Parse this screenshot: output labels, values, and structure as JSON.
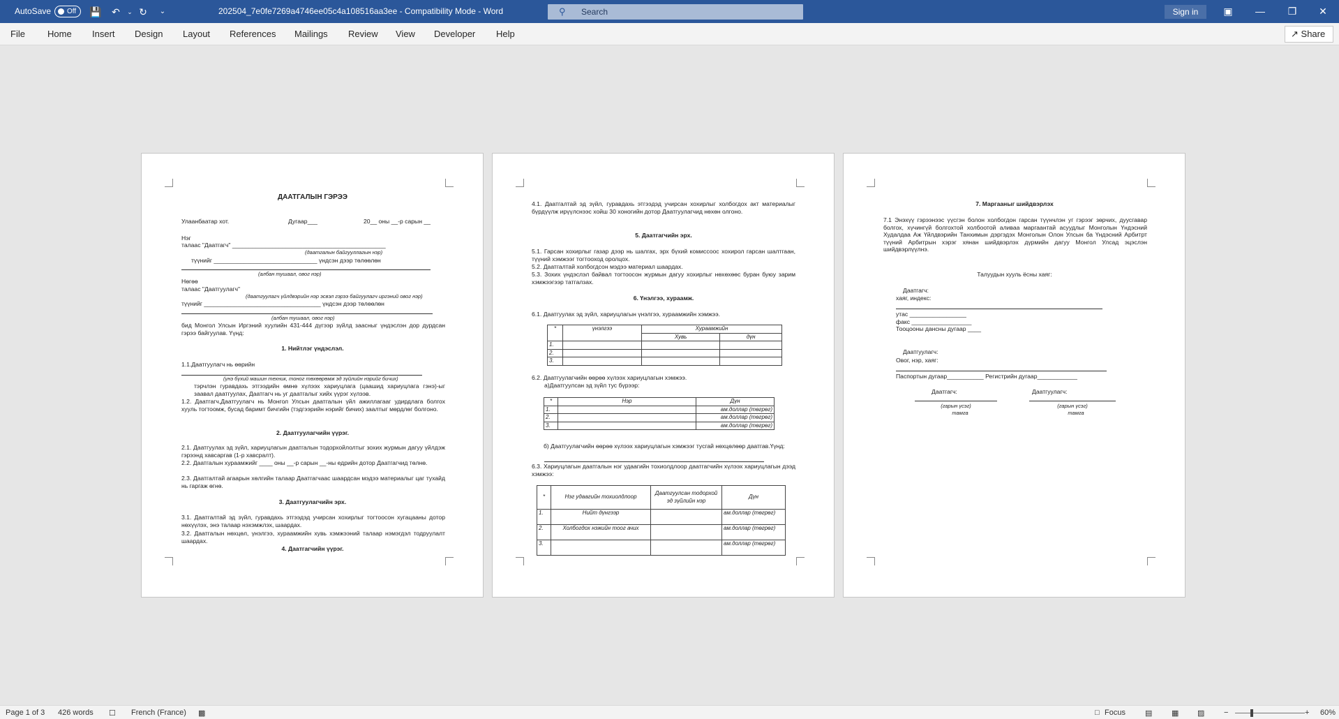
{
  "titlebar": {
    "autosave_label": "AutoSave",
    "autosave_state": "Off",
    "doc_title": "202504_7e0fe7269a4746ee05c4a108516aa3ee  -  Compatibility Mode  -  Word",
    "search_placeholder": "Search",
    "signin_label": "Sign in"
  },
  "ribbon": {
    "tabs": [
      "File",
      "Home",
      "Insert",
      "Design",
      "Layout",
      "References",
      "Mailings",
      "Review",
      "View",
      "Developer",
      "Help"
    ],
    "share_label": "Share"
  },
  "page1": {
    "title": "ДААТГАЛЫН ГЭРЭЭ",
    "city": "Улаанбаатар хот.",
    "number": "Дугаар___",
    "date": "20__ оны __-р сарын __",
    "l1": "Нэг",
    "l2": "талаас  \"Даатгагч\" ______________________________________________",
    "l3": "(даатгалын байгууллагын нэр)",
    "l4": "түүнийг _______________________________ үндсэн дээр төлөөлөн",
    "l5": "(албан тушаал, овог нэр)",
    "l6": "Нөгөө",
    "l7": "талаас  \"Даатгуулагч\"",
    "l8": "(даатгуулагч үйлдвэрийн нэр эсвэл гэрээ байгуулагч иргэний овог нэр)",
    "l9": "түүнийг ___________________________________ үндсэн дээр төлөөлөн",
    "l10": "(албан тушаал, овог нэр)",
    "l11": "бид Монгол Улсын Иргэний хуулийн 431-444 дүгээр зүйлд заасныг үндэслэн дор дурдсан гэрээ байгуулав. Үүнд:",
    "h1": "1. Нийтлэг үндэслэл.",
    "p11": "1.1.Даатгуулагч нь өөрийн",
    "p11i": "(үнэ бүхий машин техник, тоног төхөөрөмж эд зүйлийн нэрийг бичих)",
    "p11b": "тэрчлэн гуравдахь этгээдийн өмнө хүлээх хариуцлага (цаашид хариуцлага гэнэ)-ыг заавал даатгуулах, Даатгагч нь уг даатгалыг хийх үүрэг хүлээв.",
    "p12": "1.2. Даатгагч,Даатгуулагч нь Монгол Улсын даатгалын үйл ажиллагааг удирдлага болгох хууль тогтоомж, бусад баримт бичгийн (тэдгээрийн нэрийг бичих) заалтыг мөрдлөг болгоно.",
    "h2": "2. Даатгуулагчийн үүрэг.",
    "p21": "2.1. Даатгуулах эд зүйл, хариуцлагын даатгалын тодорхойлолтыг зохих журмын дагуу үйлдэж гэрээнд хавсаргав (1-р хавсралт).",
    "p22": "2.2. Даатгалын хураамжийг ____ оны __-р сарын __-ны едрийн дотор Даатгагчид төлнө.",
    "p23": "2.3. Даатгалтай агаарын хөлгийн талаар Даатгагчаас шаардсан мэдээ материалыг цаг тухайд нь гаргаж өгнө.",
    "h3": "3. Даатгуулагчийн эрх.",
    "p31": "3.1. Даатгалтай эд зүйл, гуравдахь этгээдэд учирсан хохирлыг тогтоосон хугацааны дотор нөхүүлэх, энэ талаар нэхэмжлэх, шаардах.",
    "p32": "3.2. Даатгалын нөхцөл, үнэлгээ, хураамжийн хувь хэмжээний талаар нэмэгдэл тодруулалт шаардах.",
    "h4": "4. Даатгагчийн үүрэг."
  },
  "page2": {
    "p41": "4.1. Даатгалтай эд зүйл, гуравдахь этгээдэд учирсан хохирлыг холбогдох акт материалыг бүрдүүлж ирүүлснээс хойш 30 хоногийн дотор Даатгуулагчид нөхөн олгоно.",
    "h5": "5. Даатгагчийн эрх.",
    "p51": "5.1. Гарсан хохирлыг газар дээр нь шалгах, эрх бүхий комиссоос хохирол гарсан шалтгаан, түүний хэмжээг тогтооход оролцох.",
    "p52": "5.2. Даатгалтай холбогдсон мэдээ материал шаардах.",
    "p53": "5.3. Зохих үндэслэл байвал тогтоосон журмын дагуу хохирлыг нөхөхөөс буран буюу зарим хэмжээгээр татгалзах.",
    "h6": "6. Үнэлгээ, хураамж.",
    "p61": "6.1. Даатгуулах эд зүйл, хариуцлагын үнэлгээ, хураамжийн хэмжээ.",
    "t1": {
      "h_num": "*",
      "h_val": "үнэлгээ",
      "h_fee": "Хураамжийн",
      "h_pct": "Хувь",
      "h_amt": "дүн",
      "rows": [
        "1.",
        "2.",
        "3."
      ]
    },
    "p62": "6.2. Даатгуулагчийн өөрөө хүлээх хариуцлагын хэмжээ.",
    "p62a": "а)Даатгуулсан эд зүйл тус бүрээр:",
    "t2": {
      "h_num": "*",
      "h_name": "Нэр",
      "h_amt": "Дүн",
      "rows": [
        {
          "n": "1.",
          "amt": "ам.доллар (төгрөг)"
        },
        {
          "n": "2.",
          "amt": "ам.доллар (төгрөг)"
        },
        {
          "n": "3.",
          "amt": "ам.доллар (төгрөг)"
        }
      ]
    },
    "p62b": "б) Даатгуулагчийн өөрөө хүлээх хариуцлагын хэмжээг тусгай нөхцөлөөр даатгав.Үүнд:",
    "p63": "6.3. Хариуцлагын даатгалын нэг удаагийн тохиолдлоор даатгагчийн хүлээх хариуцлагын дээд хэмжээ:",
    "t3": {
      "h_num": "*",
      "h_case": "Нэг удаагийн тохиолдлоор",
      "h_item": "Даатгуулсан тодорхой эд зүйлийн нэр",
      "h_amt": "Дүн",
      "rows": [
        {
          "n": "1.",
          "case": "Нийт дүнгээр",
          "amt": "ам.доллар (төгрөг)"
        },
        {
          "n": "2.",
          "case": "Холбогдох нэжийн тоог ачих",
          "amt": "ам.доллар (төгрөг)"
        },
        {
          "n": "3.",
          "case": "",
          "amt": "ам.доллар (төгрөг)"
        }
      ]
    }
  },
  "page3": {
    "h7": "7. Маргааныг шийдвэрлэх",
    "p71": "7.1 Энэхүү гэрээнээс үүсгэн болон холбогдон гарсан түүнчлэн уг гэрээг зөрчих, дуусгавар болгох, хүчингүй болгохтой холбоотой аливаа маргаантай асуудлыг Монголын Үндэсний Худалдаа Аж Үйлдвэрийн Танхимын дэргэдэх Монголын Олон Улсын ба Үндэсний Арбитрт түүний Арбитрын хэрэг хянан шийдвэрлэх дүрмийн дагуу Монгол Улсад эцэслэн шийдвэрлүүлнэ.",
    "addr_title": "Талуудын хууль ёсны хаяг:",
    "insurer": "Даатгагч:",
    "addr_index": "хаяг, индекс:",
    "phone": "утас _________________",
    "fax": "факс __________________",
    "account": "Тооцооны дансны дугаар ____",
    "insured": "Даатгуулагч:",
    "name_addr": "Овог, нэр, хаяг:",
    "passport": "Паспортын дугаар___________ Регистрийн дугаар____________",
    "sig_insurer": "Даатгагч:",
    "sig_insured": "Даатгуулагч:",
    "sig_note": "(гарын үсэг)",
    "stamp": "тамга"
  },
  "status": {
    "page": "Page 1 of 3",
    "words": "426 words",
    "language": "French (France)",
    "focus": "Focus",
    "zoom": "60%"
  }
}
